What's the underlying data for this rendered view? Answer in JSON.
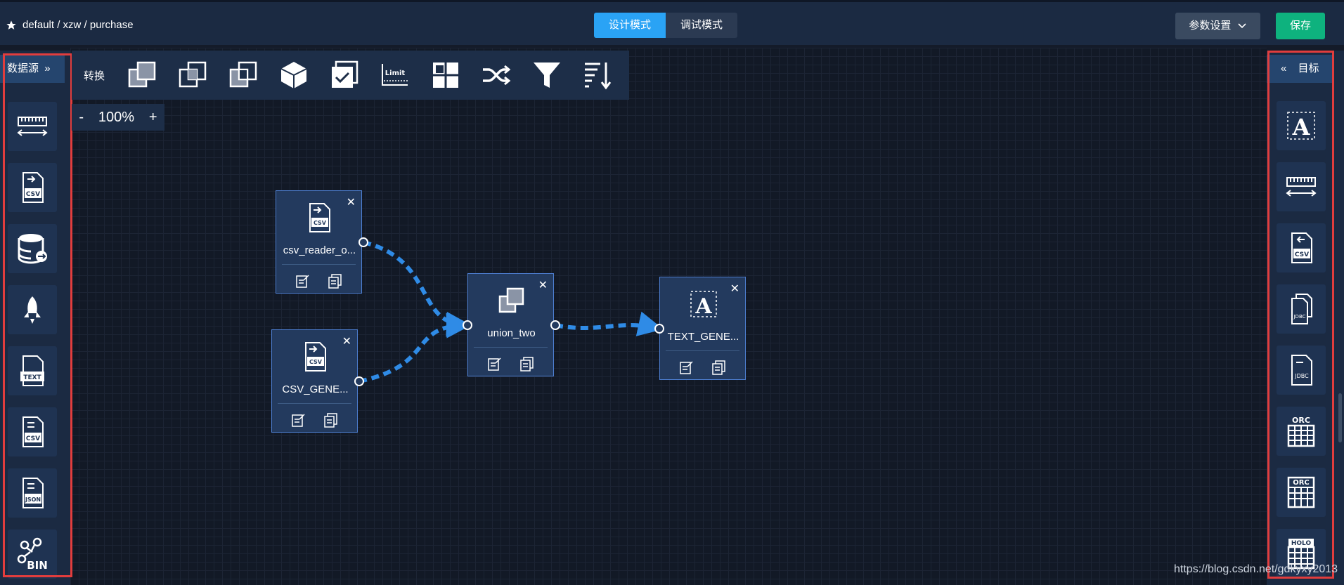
{
  "header": {
    "breadcrumb": "default / xzw / purchase",
    "modes": [
      "设计模式",
      "调试模式"
    ],
    "active_mode": "设计模式",
    "params_label": "参数设置",
    "save_label": "保存"
  },
  "left_panel": {
    "title": "数据源",
    "items": [
      "ruler-arrows-icon",
      "csv-import-icon",
      "jdbc-db-icon",
      "rocket-icon",
      "text-file-icon",
      "csv-convert-icon",
      "json-file-icon",
      "bin-network-icon"
    ]
  },
  "right_panel": {
    "title": "目标",
    "items": [
      "text-target-icon",
      "ruler-arrows-icon",
      "csv-export-icon",
      "jdbc-files-icon",
      "jdbc-file-icon",
      "orc-grid-icon",
      "orc-grid-convert-icon",
      "holo-grid-icon"
    ]
  },
  "toolbar": {
    "label": "转换",
    "tools": [
      "union-icon",
      "intersect-icon",
      "difference-icon",
      "cube-icon",
      "check-copy-icon",
      "limit-icon",
      "grid-icon",
      "shuffle-icon",
      "filter-icon",
      "sort-icon"
    ]
  },
  "zoom": {
    "minus": "-",
    "value": "100%",
    "plus": "+"
  },
  "nodes": [
    {
      "id": "n1",
      "label": "csv_reader_o...",
      "icon": "csv-file-icon"
    },
    {
      "id": "n2",
      "label": "CSV_GENE...",
      "icon": "csv-file-icon"
    },
    {
      "id": "n3",
      "label": "union_two",
      "icon": "union-icon"
    },
    {
      "id": "n4",
      "label": "TEXT_GENE...",
      "icon": "text-target-icon"
    }
  ],
  "edges": [
    [
      "n1",
      "n3"
    ],
    [
      "n2",
      "n3"
    ],
    [
      "n3",
      "n4"
    ]
  ],
  "colors": {
    "accent": "#2aa3f5",
    "save": "#0eb27e",
    "edge": "#2f8be6",
    "highlight": "#e23d3d"
  },
  "watermark": "https://blog.csdn.net/gdkyxy2013"
}
